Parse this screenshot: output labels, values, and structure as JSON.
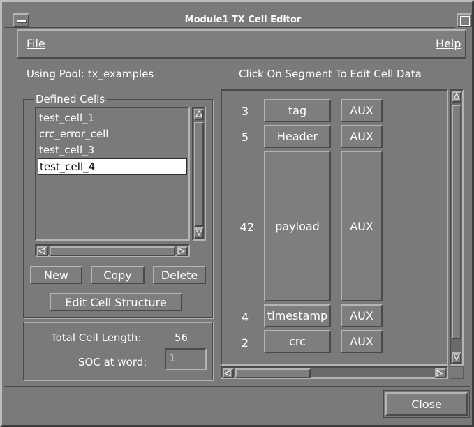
{
  "window": {
    "title": "Module1 TX Cell Editor"
  },
  "menubar": {
    "file": "File",
    "help": "Help"
  },
  "pool": {
    "label": "Using Pool: tx_examples"
  },
  "instruction": "Click On Segment To Edit Cell Data",
  "defined_cells": {
    "title": "Defined Cells",
    "items": [
      "test_cell_1",
      "crc_error_cell",
      "test_cell_3",
      "test_cell_4"
    ],
    "selected_index": 3,
    "buttons": {
      "new": "New",
      "copy": "Copy",
      "delete": "Delete",
      "edit_structure": "Edit Cell Structure"
    }
  },
  "summary": {
    "total_label": "Total Cell Length:",
    "total_value": "56",
    "soc_label": "SOC at word:",
    "soc_value": "1"
  },
  "segments": [
    {
      "length": "3",
      "name": "tag",
      "aux": "AUX"
    },
    {
      "length": "5",
      "name": "Header",
      "aux": "AUX"
    },
    {
      "length": "42",
      "name": "payload",
      "aux": "AUX"
    },
    {
      "length": "4",
      "name": "timestamp",
      "aux": "AUX"
    },
    {
      "length": "2",
      "name": "crc",
      "aux": "AUX"
    }
  ],
  "close_label": "Close",
  "colors": {
    "background": "#7a7a7a",
    "title_bar": "#7a7a7a",
    "selection": "#ffffff",
    "text": "#ffffff"
  }
}
